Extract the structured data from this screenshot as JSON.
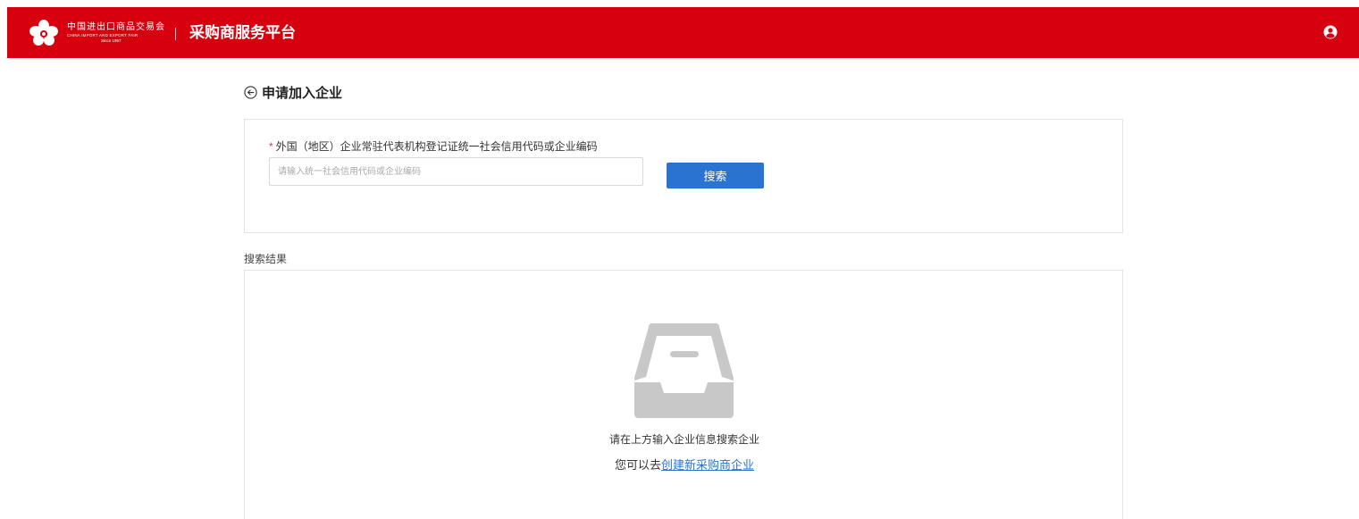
{
  "header": {
    "logo_cn": "中国进出口商品交易会",
    "logo_en": "CHINA IMPORT AND EXPORT FAIR",
    "logo_since": "Since 1957",
    "platform_title": "采购商服务平台",
    "user_icon": "user-circle-icon",
    "bg_color": "#d7000f"
  },
  "page": {
    "back_icon": "back-arrow-circle-icon",
    "title": "申请加入企业"
  },
  "search": {
    "required_mark": "*",
    "label": "外国（地区）企业常驻代表机构登记证统一社会信用代码或企业编码",
    "value": "",
    "placeholder": "请输入统一社会信用代码或企业编码",
    "button_label": "搜索",
    "button_color": "#2b73d0"
  },
  "results": {
    "label": "搜索结果",
    "empty_icon": "empty-inbox-icon",
    "empty_text": "请在上方输入企业信息搜索企业",
    "create_prefix": "您可以去",
    "create_link": "创建新采购商企业"
  }
}
